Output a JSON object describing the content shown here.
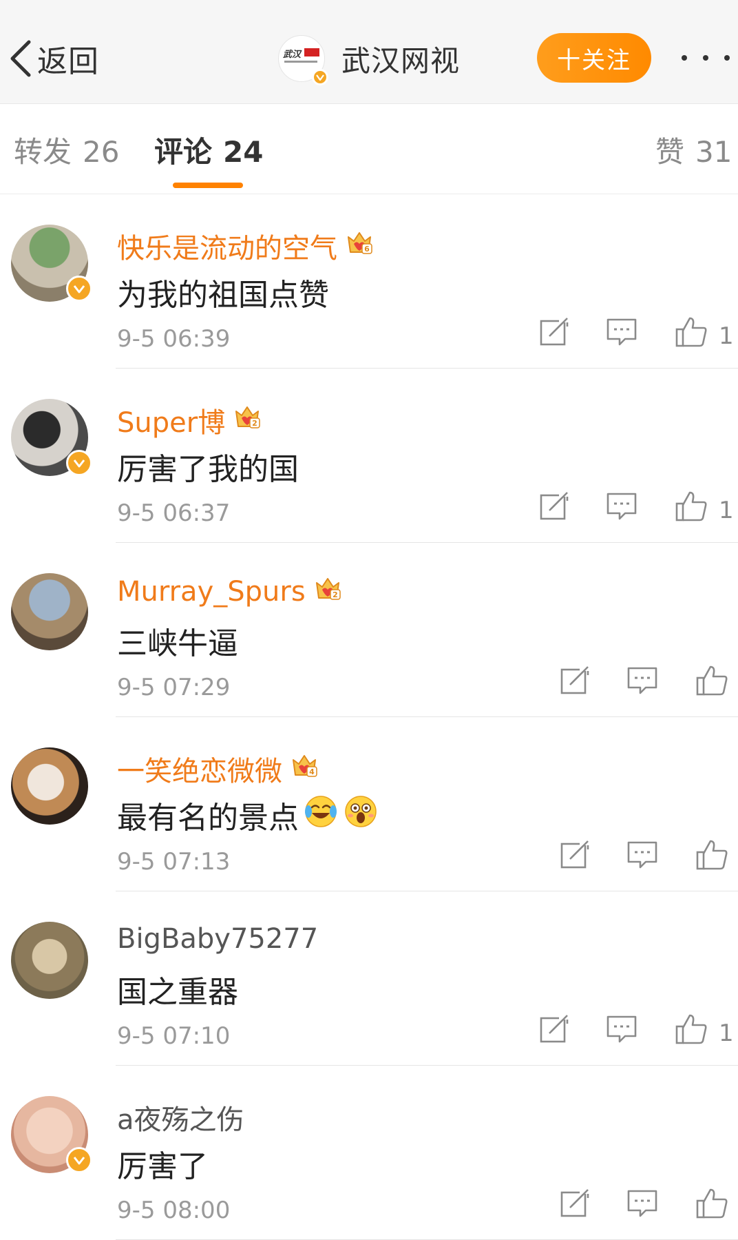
{
  "header": {
    "back_label": "返回",
    "account_name": "武汉网视",
    "follow_label": "十关注"
  },
  "tabs": {
    "repost": {
      "label": "转发",
      "count": "26"
    },
    "comments": {
      "label": "评论",
      "count": "24"
    },
    "likes": {
      "label": "赞",
      "count": "31"
    }
  },
  "colors": {
    "accent": "#ff8200",
    "vip_name": "#f07b1a",
    "verified_badge": "#f5a623"
  },
  "comments": [
    {
      "user": "快乐是流动的空气",
      "vip": true,
      "vip_level": "6",
      "verified": true,
      "text": "为我的祖国点赞",
      "time": "9-5 06:39",
      "likes": "1"
    },
    {
      "user": "Super博",
      "vip": true,
      "vip_level": "2",
      "verified": true,
      "text": "厉害了我的国",
      "time": "9-5 06:37",
      "likes": "1"
    },
    {
      "user": "Murray_Spurs",
      "vip": true,
      "vip_level": "2",
      "verified": false,
      "text": "三峡牛逼",
      "time": "9-5 07:29",
      "likes": ""
    },
    {
      "user": "一笑绝恋微微",
      "vip": true,
      "vip_level": "4",
      "verified": false,
      "text": "最有名的景点",
      "emojis": [
        "laugh-cry-emoji",
        "wow-emoji"
      ],
      "time": "9-5 07:13",
      "likes": ""
    },
    {
      "user": "BigBaby75277",
      "vip": false,
      "verified": false,
      "text": "国之重器",
      "time": "9-5 07:10",
      "likes": "1"
    },
    {
      "user": "a夜殇之伤",
      "vip": false,
      "verified": true,
      "text": "厉害了",
      "time": "9-5 08:00",
      "likes": ""
    }
  ]
}
